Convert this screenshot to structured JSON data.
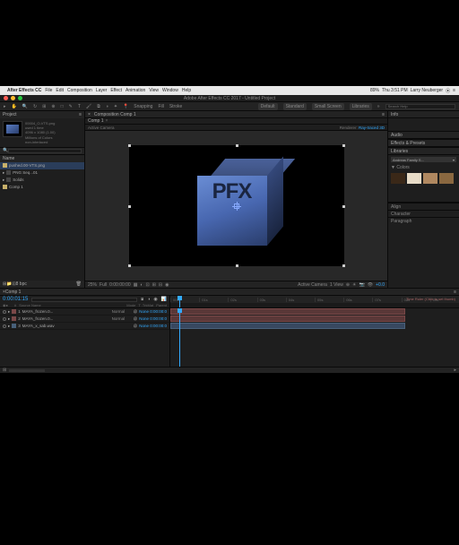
{
  "menubar": {
    "apple": "",
    "app": "After Effects CC",
    "items": [
      "File",
      "Edit",
      "Composition",
      "Layer",
      "Effect",
      "Animation",
      "View",
      "Window",
      "Help"
    ],
    "battery": "89%",
    "clock": "Thu 3:51 PM",
    "user": "Larry Neuberger"
  },
  "titlebar": {
    "title": "Adobe After Effects CC 2017 - Untitled Project"
  },
  "toolbar": {
    "snapping": "Snapping",
    "fill": "Fill",
    "stroke": "Stroke",
    "workspace_default": "Default",
    "workspace_standard": "Standard",
    "workspace_small": "Small Screen",
    "libraries": "Libraries",
    "search_ph": "Search Help"
  },
  "project": {
    "panel": "Project",
    "asset_name": "00004_O-VTS.png",
    "asset_used": "used 1 time",
    "asset_dims": "4096 x 1080 (1.00)",
    "asset_color": "Millions of Colors",
    "asset_alpha": "non-interlaced",
    "name_col": "Name",
    "items": [
      {
        "name": "pushed.00-VTS.png",
        "type": "comp"
      },
      {
        "name": "PNG Seq...01",
        "type": "fold"
      },
      {
        "name": "Solids",
        "type": "fold"
      },
      {
        "name": "Comp 1",
        "type": "comp"
      }
    ]
  },
  "comp": {
    "crumb": "Composition Comp 1",
    "tab": "Comp 1",
    "camera": "Active Camera",
    "renderer": "Renderer:",
    "renderer_val": "Ray-traced 3D",
    "cube_text": "PFX",
    "zoom": "25%",
    "res": "Full",
    "view_cam": "Active Camera",
    "views": "1 View",
    "timecode": "0:00:00:00"
  },
  "right": {
    "info": "Info",
    "audio": "Audio",
    "effects": "Effects & Presets",
    "libraries": "Libraries",
    "lib_name": "Andreas Family S...",
    "colors_label": "▼ Colors",
    "align": "Align",
    "character": "Character",
    "paragraph": "Paragraph"
  },
  "timeline": {
    "tab": "Comp 1",
    "timecode": "0:00:01:15",
    "cols": {
      "num": "#",
      "source": "Source Name",
      "mode": "Mode",
      "trk": "T .TrkMat",
      "parent": "Parent"
    },
    "ruler": [
      "00s",
      "01s",
      "02s",
      "03s",
      "04s",
      "05s",
      "06s",
      "07s",
      "08s",
      "09s"
    ],
    "hint": "Time Ruler (Click to set thumb)",
    "layers": [
      {
        "n": "1",
        "name": "MAYA_frozen.0...",
        "mode": "Normal",
        "parent": "None",
        "in": "0:00:00:0"
      },
      {
        "n": "2",
        "name": "MAYA_frozen.0...",
        "mode": "Normal",
        "parent": "None",
        "in": "0:00:00:0"
      },
      {
        "n": "3",
        "name": "MAYA_x_sab.wav",
        "mode": "",
        "parent": "None",
        "in": "0:00:00:0"
      }
    ]
  }
}
